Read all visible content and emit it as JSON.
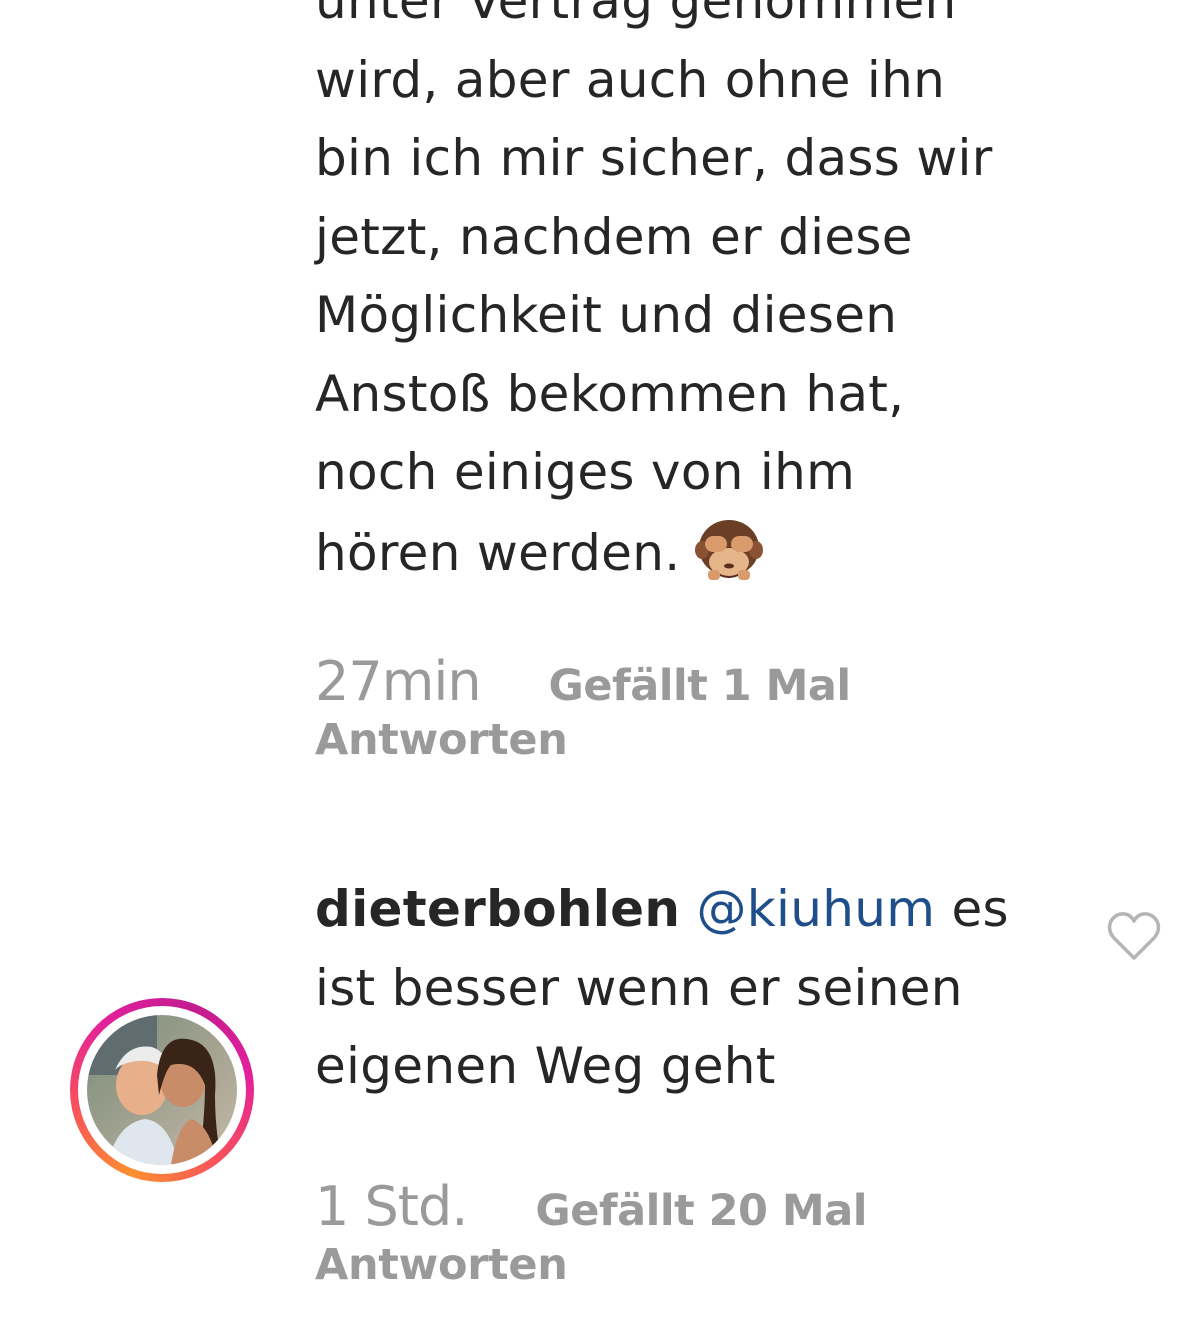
{
  "comments": [
    {
      "lines": [
        "unter Vertrag genommen",
        "wird, aber auch ohne ihn",
        "bin ich mir sicher, dass wir",
        "jetzt, nachdem er diese",
        "Möglichkeit und diesen",
        "Anstoß bekommen hat,",
        "noch einiges von ihm",
        "hören werden."
      ],
      "emoji": "see-no-evil-monkey",
      "time": "27min",
      "likes": "Gefällt 1 Mal",
      "reply": "Antworten"
    },
    {
      "username": "dieterbohlen",
      "mention": "@kiuhum",
      "line1_rest": "es",
      "lines": [
        "ist besser wenn er seinen",
        "eigenen Weg geht"
      ],
      "time": "1 Std.",
      "likes": "Gefällt 20 Mal",
      "reply": "Antworten",
      "avatar": "profile-photo-with-story-ring"
    }
  ],
  "icons": {
    "like": "heart-outline-icon"
  },
  "colors": {
    "text": "#262626",
    "meta": "#9a9a9a",
    "mention": "#1f4f8a",
    "story_ring_start": "#fd8f2f",
    "story_ring_end": "#c21c8e"
  }
}
